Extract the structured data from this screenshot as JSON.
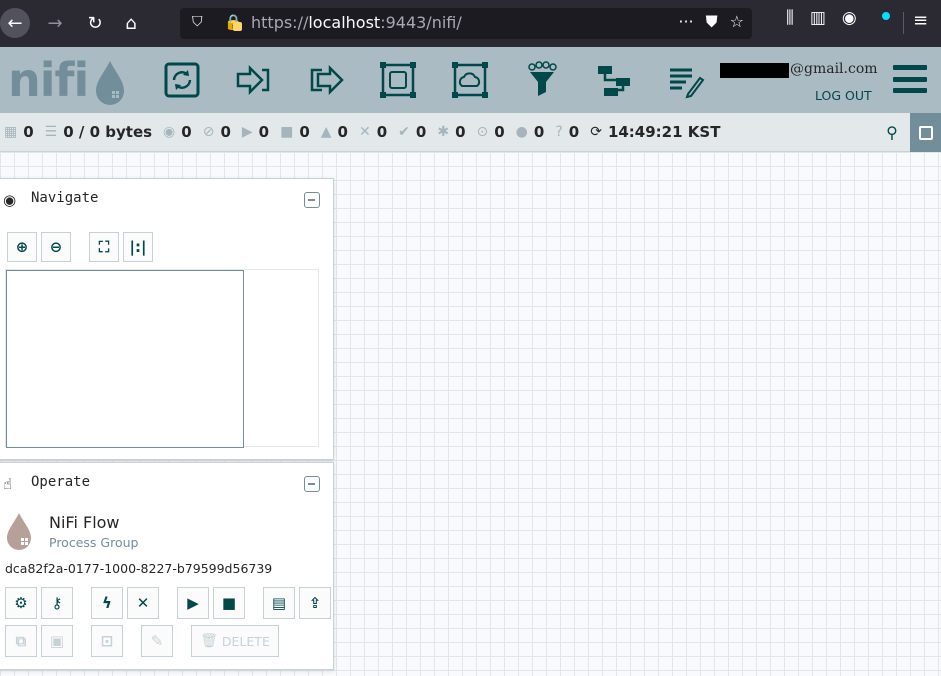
{
  "browser": {
    "url_scheme": "https://",
    "url_host": "localhost",
    "url_rest": ":9443/nifi/",
    "icons": [
      "back-arrow-icon",
      "forward-arrow-icon",
      "reload-icon",
      "home-icon",
      "shield-icon",
      "lock-icon",
      "more-icon",
      "pocket-icon",
      "star-icon",
      "library-icon",
      "sidebar-icon",
      "profile-icon",
      "menu-icon"
    ]
  },
  "header": {
    "logo_text": "nifi",
    "toolbar": [
      "processor",
      "input-port",
      "output-port",
      "process-group",
      "remote-process-group",
      "funnel",
      "template",
      "label"
    ],
    "user_email": "@gmail.com",
    "logout_label": "LOG OUT"
  },
  "status": {
    "threads": "0",
    "queued": "0 / 0 bytes",
    "transmitting": "0",
    "not_transmitting": "0",
    "running": "0",
    "stopped": "0",
    "invalid": "0",
    "disabled": "0",
    "up_to_date": "0",
    "locally_modified": "0",
    "stale": "0",
    "locally_modified_stale": "0",
    "sync_failure": "0",
    "last_refreshed": "14:49:21 KST"
  },
  "navigate": {
    "title": "Navigate"
  },
  "operate": {
    "title": "Operate",
    "entity_name": "NiFi Flow",
    "entity_type": "Process Group",
    "entity_id": "dca82f2a-0177-1000-8227-b79599d56739",
    "delete_label": "DELETE"
  },
  "colors": {
    "header_bg": "#aabbc3",
    "status_bg": "#e3e8eb",
    "accent": "#004849",
    "logo": "#728e9b"
  }
}
